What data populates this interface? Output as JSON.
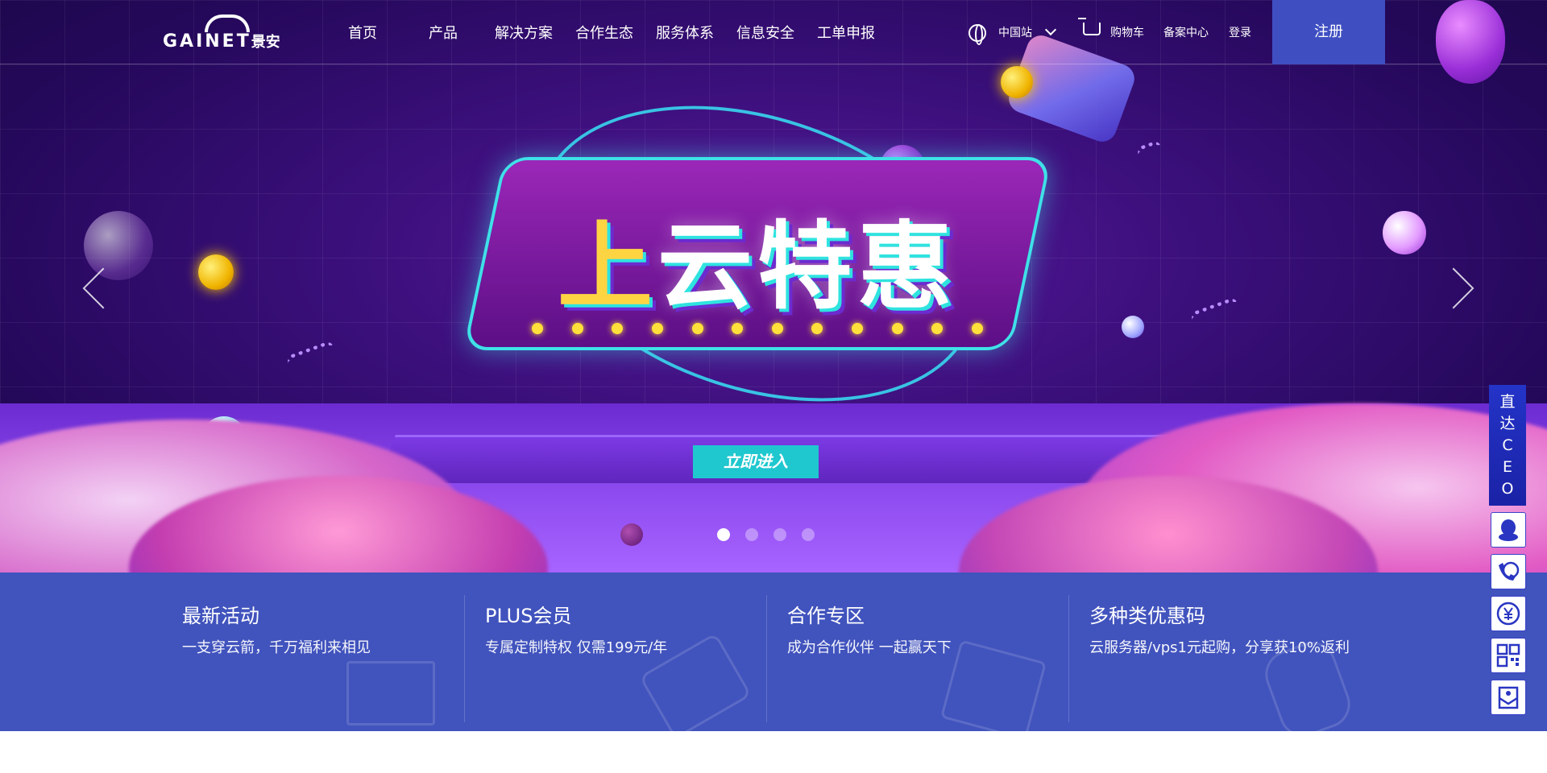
{
  "header": {
    "logo_text": "GAINET",
    "logo_cn": "景安",
    "nav": [
      "首页",
      "产品",
      "解决方案",
      "合作生态",
      "服务体系",
      "信息安全",
      "工单申报"
    ],
    "region_label": "中国站",
    "cart_label": "购物车",
    "icp_label": "备案中心",
    "login_label": "登录",
    "register_label": "注册"
  },
  "hero": {
    "headline": "上云特惠",
    "cta_label": "立即进入",
    "slide_count": 4,
    "active_slide": 1
  },
  "features": [
    {
      "title": "最新活动",
      "subtitle": "一支穿云箭，千万福利来相见"
    },
    {
      "title": "PLUS会员",
      "subtitle": "专属定制特权 仅需199元/年"
    },
    {
      "title": "合作专区",
      "subtitle": "成为合作伙伴 一起赢天下"
    },
    {
      "title": "多种类优惠码",
      "subtitle": "云服务器/vps1元起购，分享获10%返利"
    }
  ],
  "side_toolbar": {
    "ceo_chars": [
      "直",
      "达",
      "C",
      "E",
      "O"
    ],
    "buttons": [
      "qq-icon",
      "phone-24-icon",
      "yuan-icon",
      "qrcode-icon",
      "feedback-icon"
    ]
  },
  "colors": {
    "band": "#4153bd",
    "register": "#3f4fc2",
    "cta": "#1fc7cf"
  }
}
